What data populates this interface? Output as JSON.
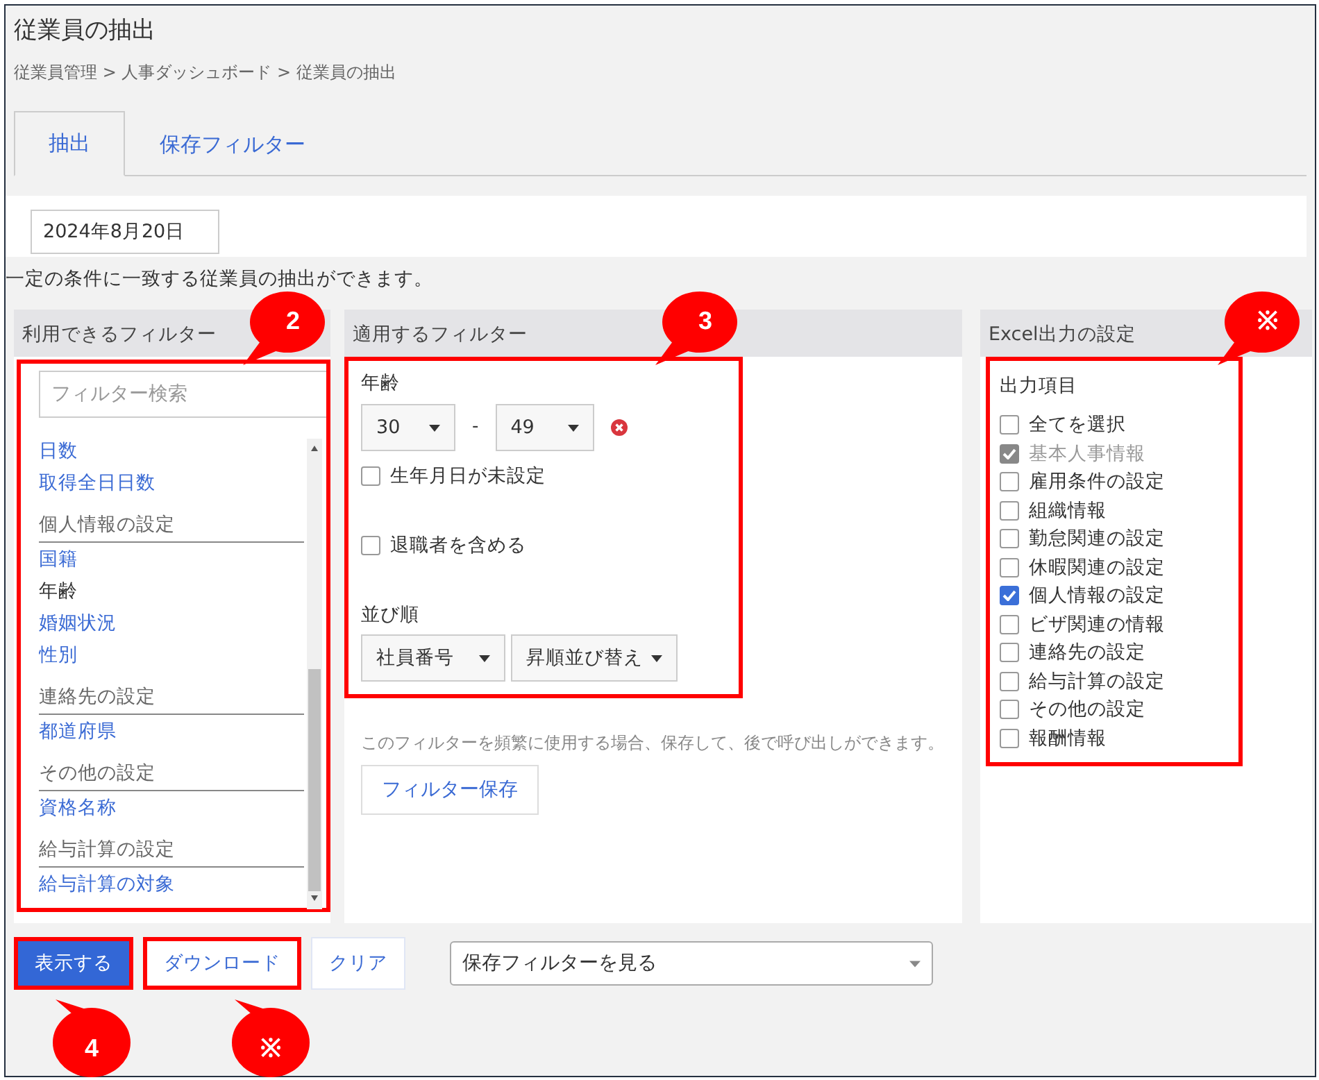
{
  "page": {
    "title": "従業員の抽出",
    "breadcrumb": "従業員管理 > 人事ダッシュボード > 従業員の抽出"
  },
  "tabs": [
    {
      "label": "抽出",
      "selected": true
    },
    {
      "label": "保存フィルター",
      "selected": false
    }
  ],
  "date_field": {
    "value": "2024年8月20日"
  },
  "description": "一定の条件に一致する従業員の抽出ができます。",
  "available_filters": {
    "title": "利用できるフィルター",
    "callout": "2",
    "highlighted": true,
    "search": {
      "placeholder": "フィルター検索"
    },
    "items": [
      {
        "kind": "item",
        "label": "日数",
        "in_use": false
      },
      {
        "kind": "item",
        "label": "取得全日日数",
        "in_use": false
      },
      {
        "kind": "group",
        "label": "個人情報の設定"
      },
      {
        "kind": "item",
        "label": "国籍",
        "in_use": false
      },
      {
        "kind": "item",
        "label": "年齢",
        "in_use": true
      },
      {
        "kind": "item",
        "label": "婚姻状況",
        "in_use": false
      },
      {
        "kind": "item",
        "label": "性別",
        "in_use": false
      },
      {
        "kind": "group",
        "label": "連絡先の設定"
      },
      {
        "kind": "item",
        "label": "都道府県",
        "in_use": false
      },
      {
        "kind": "group",
        "label": "その他の設定"
      },
      {
        "kind": "item",
        "label": "資格名称",
        "in_use": false
      },
      {
        "kind": "group",
        "label": "給与計算の設定"
      },
      {
        "kind": "item",
        "label": "給与計算の対象",
        "in_use": false
      }
    ]
  },
  "applied_filters": {
    "title": "適用するフィルター",
    "callout": "3",
    "highlighted": true,
    "age": {
      "label": "年齢",
      "from": "30",
      "separator": "-",
      "to": "49"
    },
    "checkboxes": [
      {
        "label": "生年月日が未設定",
        "checked": false
      },
      {
        "label": "退職者を含める",
        "checked": false
      }
    ],
    "sort": {
      "label": "並び順",
      "field": "社員番号",
      "order": "昇順並び替え"
    },
    "note": "このフィルターを頻繁に使用する場合、保存して、後で呼び出しができます。",
    "save_button": "フィルター保存"
  },
  "excel_output": {
    "title": "Excel出力の設定",
    "callout": "※",
    "highlighted": true,
    "label": "出力項目",
    "items": [
      {
        "label": "全てを選択",
        "checked": false,
        "disabled": false
      },
      {
        "label": "基本人事情報",
        "checked": true,
        "disabled": true
      },
      {
        "label": "雇用条件の設定",
        "checked": false,
        "disabled": false
      },
      {
        "label": "組織情報",
        "checked": false,
        "disabled": false
      },
      {
        "label": "勤怠関連の設定",
        "checked": false,
        "disabled": false
      },
      {
        "label": "休暇関連の設定",
        "checked": false,
        "disabled": false
      },
      {
        "label": "個人情報の設定",
        "checked": true,
        "disabled": false
      },
      {
        "label": "ビザ関連の情報",
        "checked": false,
        "disabled": false
      },
      {
        "label": "連絡先の設定",
        "checked": false,
        "disabled": false
      },
      {
        "label": "給与計算の設定",
        "checked": false,
        "disabled": false
      },
      {
        "label": "その他の設定",
        "checked": false,
        "disabled": false
      },
      {
        "label": "報酬情報",
        "checked": false,
        "disabled": false
      }
    ]
  },
  "actions": [
    {
      "label": "表示する",
      "primary": true,
      "highlighted": true,
      "callout": "4"
    },
    {
      "label": "ダウンロード",
      "primary": false,
      "highlighted": true,
      "callout": "※"
    },
    {
      "label": "クリア",
      "primary": false,
      "highlighted": false
    }
  ],
  "saved_filter_select": {
    "value": "保存フィルターを見る"
  }
}
